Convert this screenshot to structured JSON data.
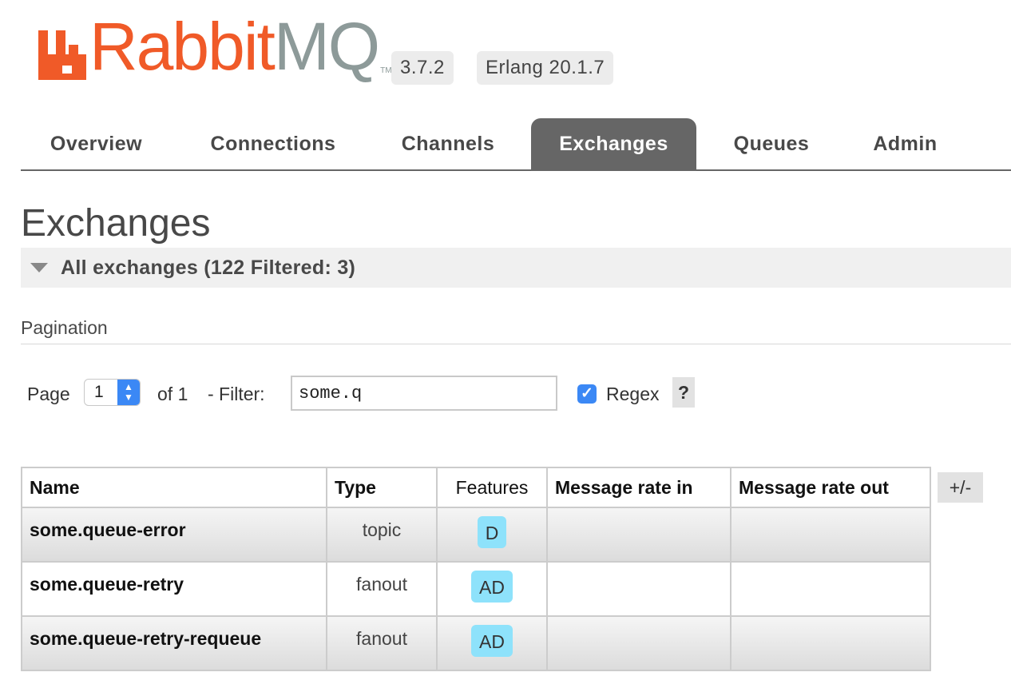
{
  "header": {
    "logo_text_rabbit": "Rabbit",
    "logo_text_mq": "MQ",
    "logo_tm": "TM",
    "version": "3.7.2",
    "erlang_version": "Erlang 20.1.7"
  },
  "nav": {
    "tabs": [
      {
        "label": "Overview",
        "active": false
      },
      {
        "label": "Connections",
        "active": false
      },
      {
        "label": "Channels",
        "active": false
      },
      {
        "label": "Exchanges",
        "active": true
      },
      {
        "label": "Queues",
        "active": false
      },
      {
        "label": "Admin",
        "active": false
      }
    ]
  },
  "page": {
    "title": "Exchanges",
    "section_title": "All exchanges (122 Filtered: 3)"
  },
  "pagination": {
    "label": "Pagination",
    "page_label": "Page",
    "page_value": "1",
    "of_label": "of 1",
    "filter_label": "- Filter:",
    "filter_value": "some.q",
    "regex_label": "Regex",
    "regex_checked": true,
    "help_label": "?"
  },
  "table": {
    "columns": [
      "Name",
      "Type",
      "Features",
      "Message rate in",
      "Message rate out"
    ],
    "columns_toggle": "+/-",
    "rows": [
      {
        "name": "some.queue-error",
        "type": "topic",
        "features": "D",
        "rate_in": "",
        "rate_out": ""
      },
      {
        "name": "some.queue-retry",
        "type": "fanout",
        "features": "AD",
        "rate_in": "",
        "rate_out": ""
      },
      {
        "name": "some.queue-retry-requeue",
        "type": "fanout",
        "features": "AD",
        "rate_in": "",
        "rate_out": ""
      }
    ]
  },
  "colors": {
    "brand_orange": "#f05a28",
    "brand_gray": "#8d9a99",
    "active_tab": "#666666",
    "feature_badge": "#8ee2fb",
    "checkbox_blue": "#3b88f5"
  }
}
